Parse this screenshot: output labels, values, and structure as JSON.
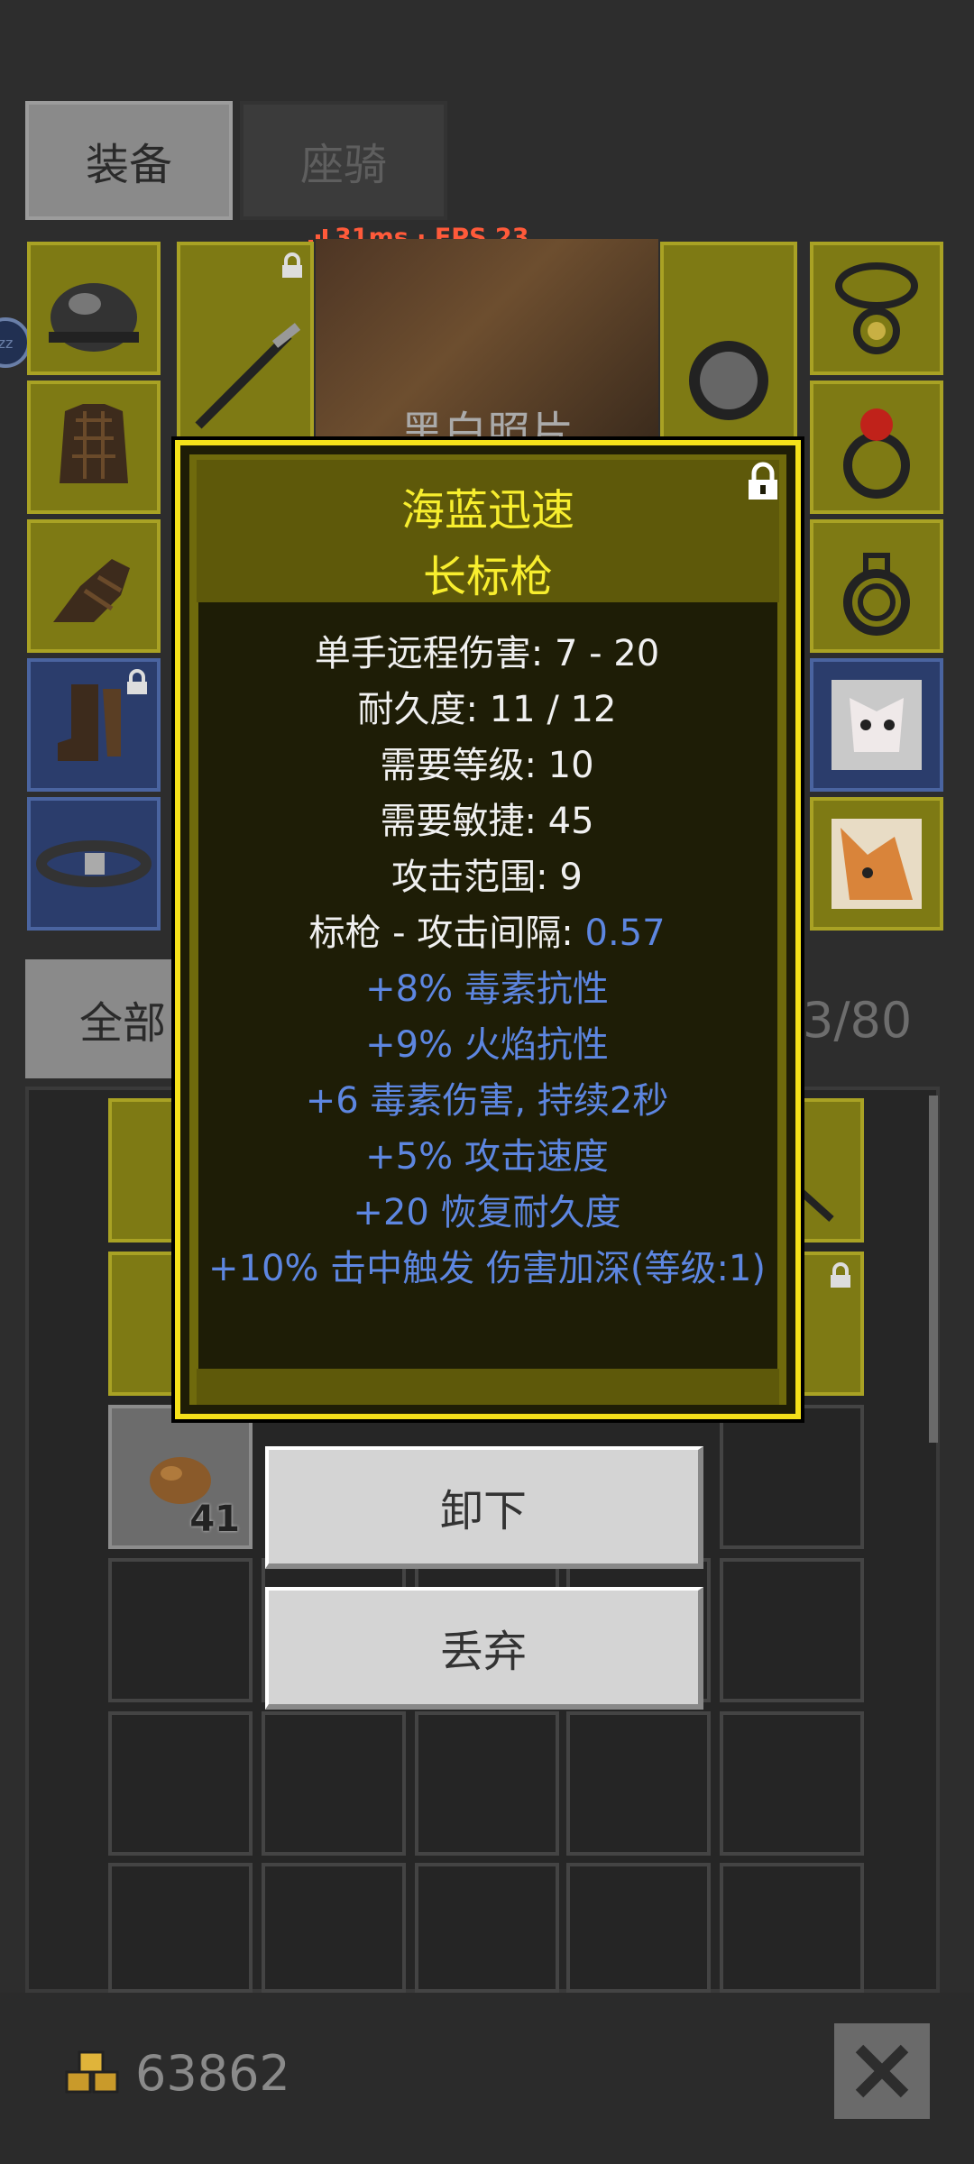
{
  "tabs": {
    "equipment": "装备",
    "mount": "座骑"
  },
  "status": {
    "ping": "31ms · FPS 23"
  },
  "center_art": {
    "caption": "黑白照片"
  },
  "filter": {
    "all": "全部"
  },
  "inventory": {
    "count": "3/80",
    "stack_count": "41"
  },
  "gold": {
    "amount": "63862"
  },
  "tooltip": {
    "name_line1": "海蓝迅速",
    "name_line2": "长标枪",
    "stats": [
      "单手远程伤害: 7 - 20",
      "耐久度: 11 / 12",
      "需要等级: 10",
      "需要敏捷: 45",
      "攻击范围: 9"
    ],
    "attack_interval_label": "标枪 - 攻击间隔: ",
    "attack_interval_value": "0.57",
    "affixes": [
      "+8% 毒素抗性",
      "+9% 火焰抗性",
      "+6 毒素伤害, 持续2秒",
      "+5% 攻击速度",
      "+20 恢复耐久度",
      "+10% 击中触发 伤害加深(等级:1)"
    ]
  },
  "actions": {
    "unequip": "卸下",
    "discard": "丢弃"
  },
  "colors": {
    "gold_text": "#f8ee2e",
    "affix_blue": "#5d86e0",
    "tooltip_border": "#f5e11a",
    "status_red": "#ff5a3a"
  }
}
